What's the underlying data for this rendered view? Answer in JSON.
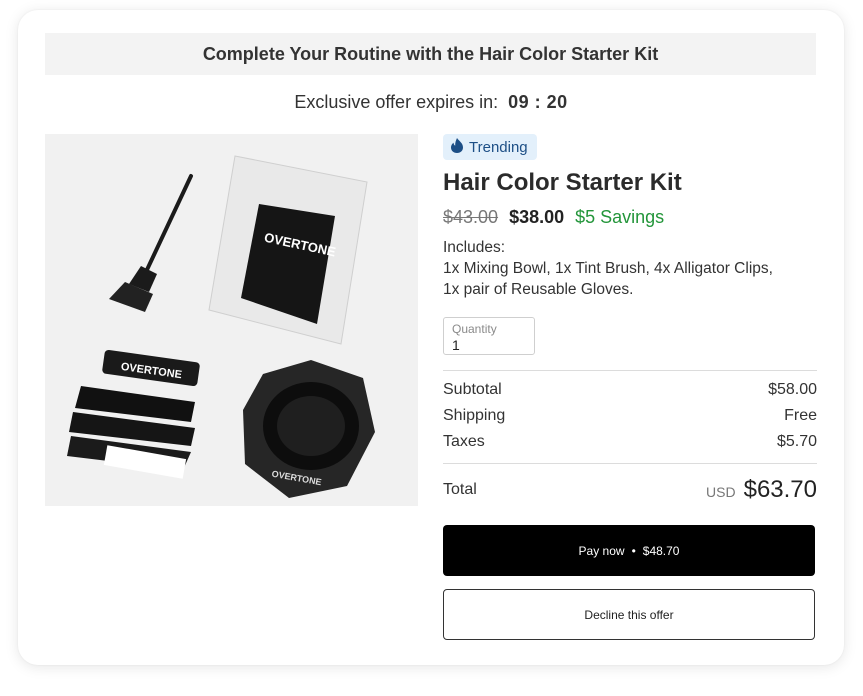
{
  "banner": {
    "title": "Complete Your Routine with the Hair Color Starter Kit"
  },
  "offer": {
    "label": "Exclusive offer expires in:",
    "time": "09 : 20"
  },
  "product": {
    "badge": "Trending",
    "title": "Hair Color Starter Kit",
    "price_original": "$43.00",
    "price_sale": "$38.00",
    "savings": "$5 Savings",
    "includes_label": "Includes:",
    "includes_line1": "1x Mixing Bowl, 1x Tint Brush, 4x Alligator Clips,",
    "includes_line2": "1x pair of Reusable Gloves.",
    "image_brand": "OVERTONE"
  },
  "quantity": {
    "label": "Quantity",
    "value": "1"
  },
  "summary": {
    "subtotal_label": "Subtotal",
    "subtotal": "$58.00",
    "shipping_label": "Shipping",
    "shipping": "Free",
    "taxes_label": "Taxes",
    "taxes": "$5.70",
    "total_label": "Total",
    "currency": "USD",
    "total": "$63.70"
  },
  "actions": {
    "pay_label": "Pay now",
    "pay_separator": "•",
    "pay_amount": "$48.70",
    "decline_label": "Decline this offer"
  },
  "colors": {
    "badge_bg": "#e3f0fb",
    "badge_text": "#1d4f86",
    "savings": "#23953a",
    "pay_button": "#000000"
  },
  "icons": {
    "badge": "flame-icon"
  }
}
